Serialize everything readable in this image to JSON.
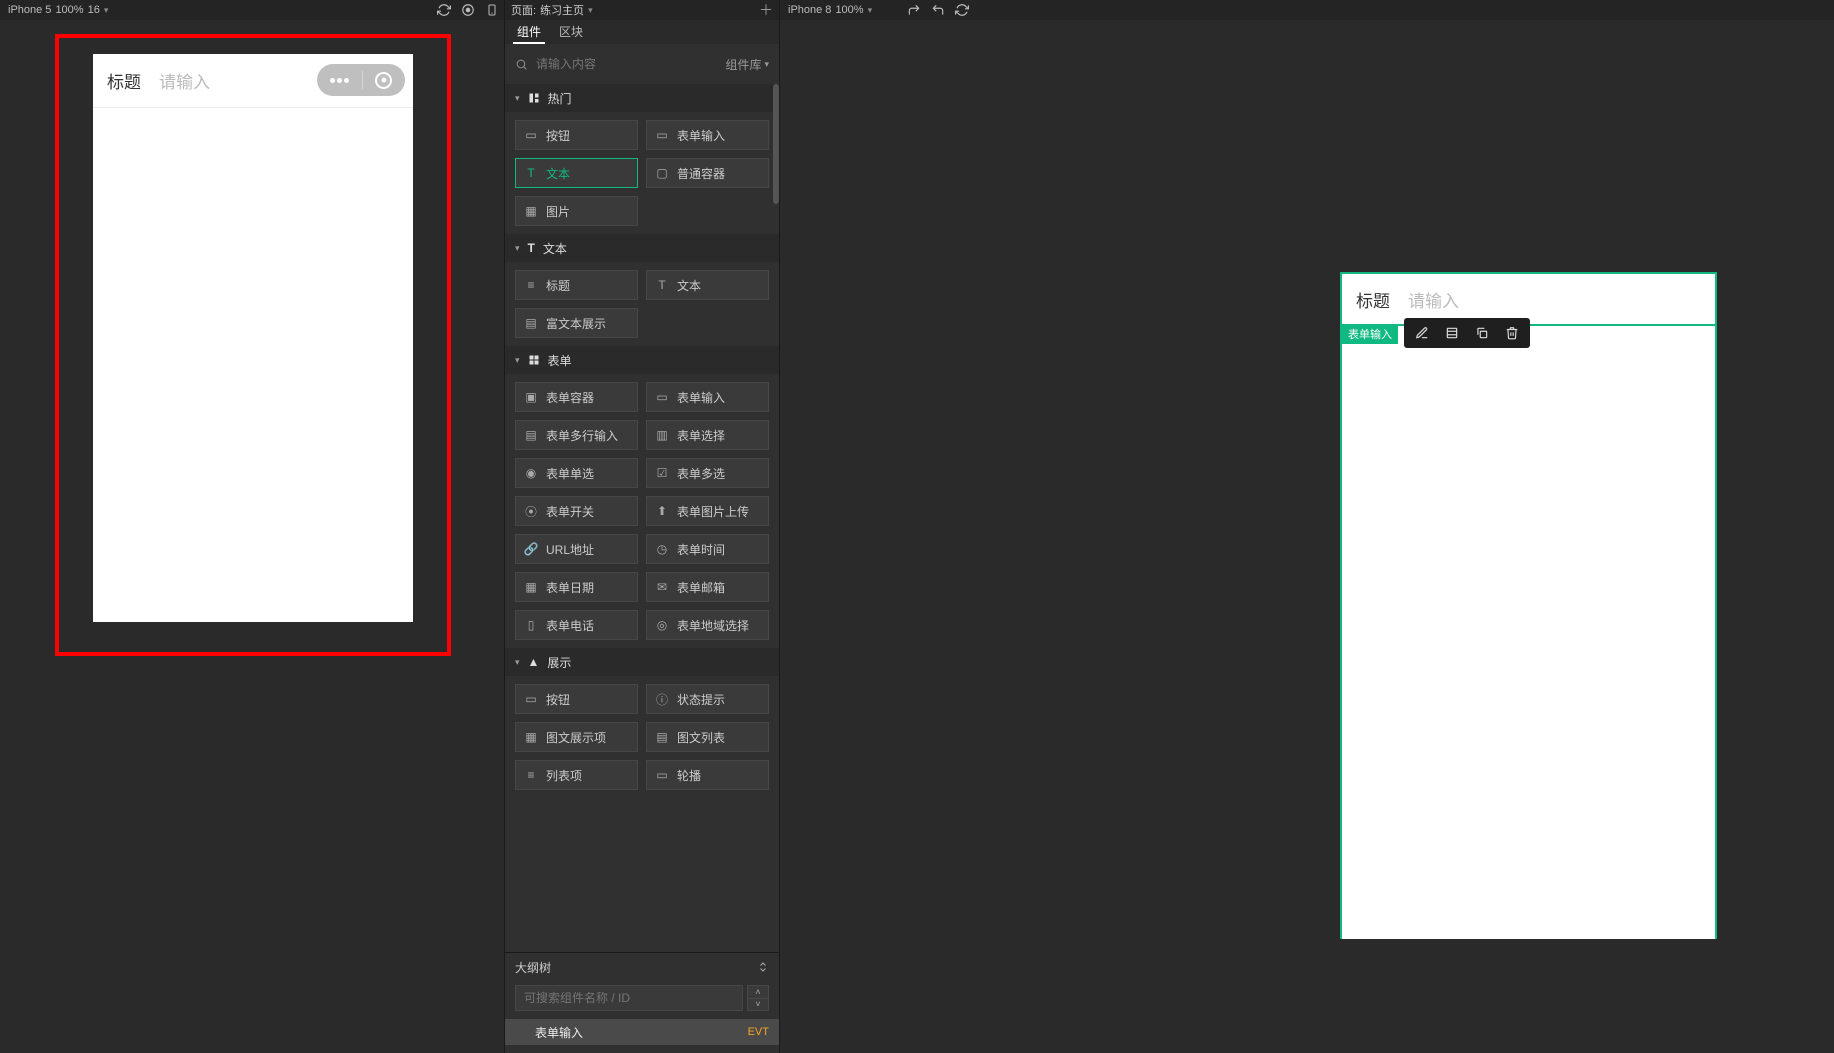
{
  "left": {
    "device": "iPhone 5",
    "zoom": "100%",
    "extra": "16",
    "header_title": "标题",
    "header_placeholder": "请输入"
  },
  "right": {
    "device": "iPhone 8",
    "zoom": "100%",
    "header_title": "标题",
    "header_placeholder": "请输入",
    "selected_tag": "表单输入"
  },
  "center": {
    "page_label_prefix": "页面:",
    "page_name": "练习主页",
    "tabs": {
      "components": "组件",
      "blocks": "区块"
    },
    "search_placeholder": "请输入内容",
    "lib_label": "组件库",
    "categories": {
      "hot": "热门",
      "text": "文本",
      "form": "表单",
      "display": "展示"
    },
    "items": {
      "button": "按钮",
      "form_input": "表单输入",
      "text": "文本",
      "container": "普通容器",
      "image": "图片",
      "heading": "标题",
      "text2": "文本",
      "richtext": "富文本展示",
      "form_container": "表单容器",
      "form_input2": "表单输入",
      "form_textarea": "表单多行输入",
      "form_select": "表单选择",
      "form_radio": "表单单选",
      "form_checkbox": "表单多选",
      "form_switch": "表单开关",
      "form_image_upload": "表单图片上传",
      "url": "URL地址",
      "form_time": "表单时间",
      "form_date": "表单日期",
      "form_email": "表单邮箱",
      "form_phone": "表单电话",
      "form_region": "表单地域选择",
      "button2": "按钮",
      "status_tip": "状态提示",
      "media_item": "图文展示项",
      "media_list": "图文列表",
      "list_item": "列表项",
      "carousel": "轮播"
    }
  },
  "outline": {
    "title": "大纲树",
    "search_placeholder": "可搜索组件名称 / ID",
    "row_label": "表单输入",
    "row_badge": "EVT"
  }
}
